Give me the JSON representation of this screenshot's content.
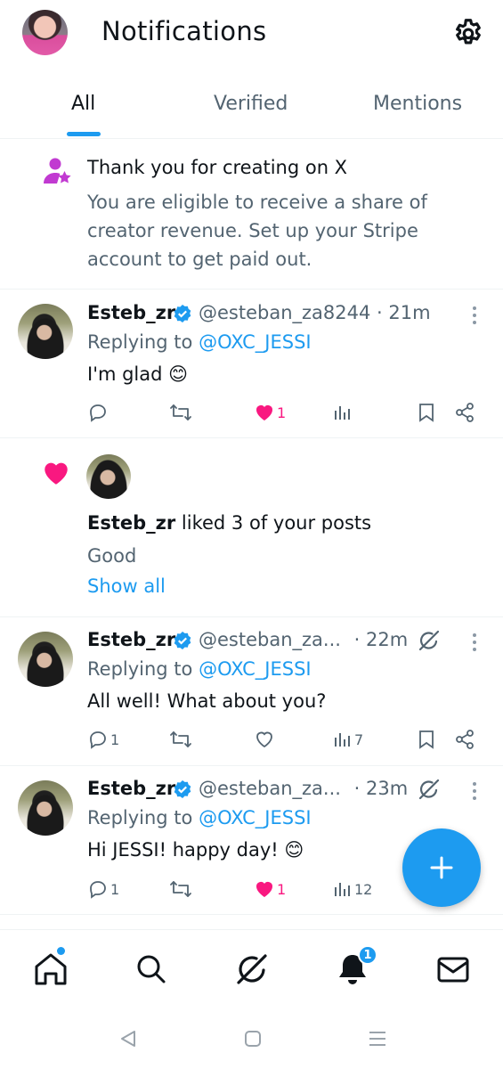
{
  "header": {
    "title": "Notifications"
  },
  "tabs": [
    {
      "label": "All"
    },
    {
      "label": "Verified"
    },
    {
      "label": "Mentions"
    }
  ],
  "revenue_notice": {
    "title": "Thank you for creating on X",
    "body": "You are eligible to receive a share of creator revenue. Set up your Stripe account to get paid out."
  },
  "notifications": [
    {
      "author": "Esteb_zr",
      "handle": "@esteban_za8244",
      "time": "· 21m",
      "replying_prefix": "Replying to ",
      "replying_to": "@OXC_JESSI",
      "text": "I'm glad 😊",
      "replies": "",
      "likes": "1",
      "views": ""
    },
    {
      "author": "Esteb_zr",
      "handle": "@esteban_za...",
      "time": "· 22m",
      "replying_prefix": "Replying to ",
      "replying_to": "@OXC_JESSI",
      "text": "All well! What about you?",
      "replies": "1",
      "likes": "",
      "views": "7"
    },
    {
      "author": "Esteb_zr",
      "handle": "@esteban_za...",
      "time": "· 23m",
      "replying_prefix": "Replying to ",
      "replying_to": "@OXC_JESSI",
      "text": "Hi JESSI! happy day! 😊",
      "replies": "1",
      "likes": "1",
      "views": "12"
    }
  ],
  "like_group": {
    "actor": "Esteb_zr",
    "summary": " liked 3 of your posts",
    "post_text": "Good",
    "show_all": "Show all"
  },
  "nav": {
    "notification_badge": "1"
  },
  "colors": {
    "accent": "#1d9bf0",
    "like": "#f91880",
    "revenue_icon": "#c13ad1"
  }
}
